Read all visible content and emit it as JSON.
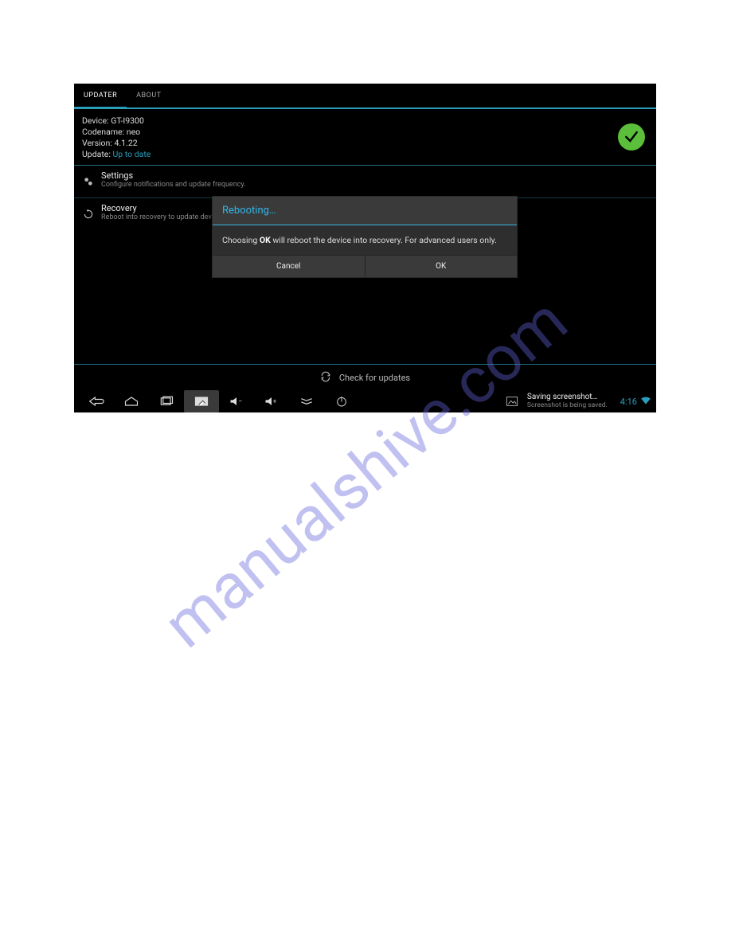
{
  "watermark": "manualshive.com",
  "tabs": {
    "updater": "UPDATER",
    "about": "ABOUT"
  },
  "info": {
    "device_label": "Device:",
    "device_value": "GT-I9300",
    "codename_label": "Codename:",
    "codename_value": "neo",
    "version_label": "Version:",
    "version_value": "4.1.22",
    "update_label": "Update:",
    "update_value": "Up to date"
  },
  "items": {
    "settings": {
      "title": "Settings",
      "sub": "Configure notifications and update frequency."
    },
    "recovery": {
      "title": "Recovery",
      "sub": "Reboot into recovery to update device."
    }
  },
  "check_updates": "Check for updates",
  "dialog": {
    "title": "Rebooting…",
    "body_pre": "Choosing ",
    "body_bold": "OK",
    "body_post": " will reboot the device into recovery. For advanced users only.",
    "cancel": "Cancel",
    "ok": "OK"
  },
  "navbar": {
    "toast_title": "Saving screenshot…",
    "toast_sub": "Screenshot is being saved.",
    "time": "4:16"
  }
}
